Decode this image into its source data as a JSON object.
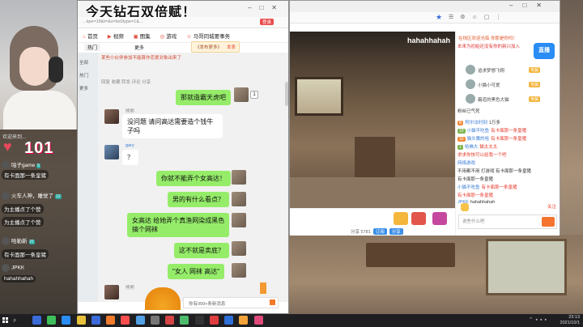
{
  "chat_window": {
    "banner": "今天钻石双倍赋！",
    "address": "...kpe=18&t=&s=bs0type=1&...",
    "login_btn": "登录",
    "nav": [
      "首页",
      "视频",
      "图集",
      "游戏",
      "马哥同城要事务"
    ],
    "nav_badge": "3",
    "subnav_hot": "热门",
    "subnav_more": "更多",
    "popup_text": "《发布更多》",
    "popup_action": "发表",
    "sidebar": [
      "全部",
      "热门",
      "更多"
    ],
    "meta_1": "某些小伙伴参加不能算作恋爱对象出来了",
    "meta_tags": "回复  收藏  转发  评论  分享",
    "messages": [
      {
        "from": "me",
        "text": "那就造霸天虎吧"
      },
      {
        "from": "them",
        "name": "熊熊",
        "text": "没问题 请问高达需要造个钱牛子吗"
      },
      {
        "from": "them2",
        "name": "gary",
        "text": "？"
      },
      {
        "from": "me",
        "text": "你就不能弄个女高达！"
      },
      {
        "from": "me",
        "text": "男的有什么看点？"
      },
      {
        "from": "me",
        "text": "女高达 给她弄个真渔网染成黑色\n搞个网袜"
      },
      {
        "from": "me",
        "text": "这不就是卖底？"
      },
      {
        "from": "me",
        "text": "\"女人 网袜 高达\""
      },
      {
        "from": "them",
        "name": "熊熊",
        "text": ""
      }
    ],
    "thumb_count": "1",
    "reply_placeholder": "你有999+条新消息"
  },
  "left_overlay": {
    "greet": "欢迎来到...",
    "big_text": "101",
    "rows": [
      {
        "name": "咕子game",
        "lv": "5",
        "msg": ""
      },
      {
        "name": "",
        "lv": "",
        "msg": "有卡面那一条皇猪"
      },
      {
        "name": "火车人神，睡觉了",
        "lv": "12",
        "msg": ""
      },
      {
        "name": "",
        "lv": "",
        "msg": "为主播点了个赞"
      },
      {
        "name": "",
        "lv": "",
        "msg": "为主播点了个赞"
      },
      {
        "name": "哈勒新",
        "lv": "21",
        "msg": ""
      },
      {
        "name": "",
        "lv": "",
        "msg": "有卡面那一条皇猪"
      },
      {
        "name": "JPKK",
        "lv": "",
        "msg": ""
      },
      {
        "name": "",
        "lv": "",
        "msg": "hahahhahah"
      }
    ]
  },
  "live_window": {
    "video_title": "hahahhahah",
    "side_top": "在线区欢迎光临 你那是你吗！",
    "side_ad": "本来为初始还没有你的新兴加入",
    "ad_logo": "直播",
    "ranks": [
      {
        "name": "追求梦想飞翔",
        "badge": "专属",
        "value": ""
      },
      {
        "name": "小猫小可爱",
        "badge": "专属",
        "value": ""
      },
      {
        "name": "霸道的黑色大猫",
        "badge": "专属",
        "value": ""
      }
    ],
    "rank_tip": "粉丝已气死",
    "feed": [
      {
        "lv": "B",
        "name": "阿尔法时刻",
        "text": "1万多",
        "cls": ""
      },
      {
        "lv": "19",
        "name": "小猫不吃鱼",
        "text": "有卡面那一条皇猪",
        "cls": "red"
      },
      {
        "lv": "16",
        "name": "猫头鹰的哈",
        "text": "有卡面那一条皇猪",
        "cls": "red"
      },
      {
        "lv": "1",
        "name": "哈佛大",
        "text": "猫太太太",
        "cls": "red"
      },
      {
        "lv": "",
        "name": "",
        "text": "求求你快可以给我一个吧",
        "cls": "red"
      },
      {
        "lv": "",
        "name": "网络游戏",
        "text": "",
        "cls": ""
      },
      {
        "lv": "",
        "name": "",
        "text": "不用都不用  打游戏  有卡面那一条皇猪",
        "cls": ""
      },
      {
        "lv": "",
        "name": "",
        "text": "有卡面那一条皇猪",
        "cls": ""
      },
      {
        "lv": "",
        "name": "小猫不吃鱼",
        "text": "有卡面那一条皇猪",
        "cls": "red"
      },
      {
        "lv": "",
        "name": "",
        "text": "有卡面那一条皇猪",
        "cls": "red"
      },
      {
        "lv": "",
        "name": "JPKK",
        "text": "hahahhahah",
        "cls": ""
      }
    ],
    "input_placeholder": "说些什么吧",
    "fav": "关注",
    "stats": "分享 5781",
    "stat_pill_1": "订阅",
    "stat_pill_2": "分享"
  },
  "taskbar": {
    "time": "23:13",
    "date": "2021/10/1"
  }
}
